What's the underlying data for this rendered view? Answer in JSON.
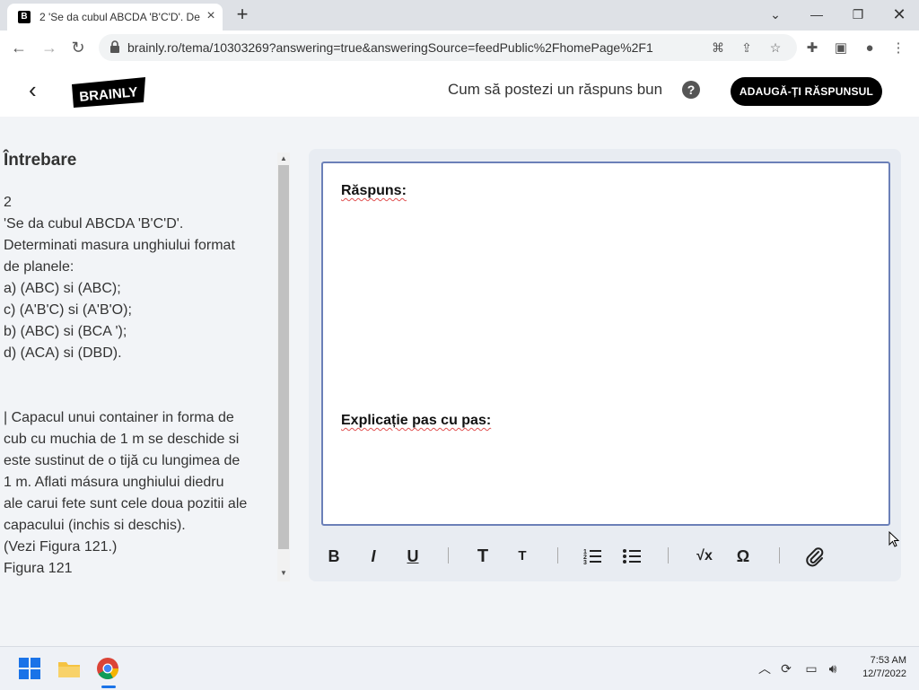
{
  "browser": {
    "tab_title": "2 'Se da cubul ABCDA 'B'C'D'. De",
    "favicon_letter": "B",
    "new_tab": "+",
    "url": "brainly.ro/tema/10303269?answering=true&answeringSource=feedPublic%2FhomePage%2F1"
  },
  "header": {
    "logo_text": "BRAINLY",
    "help_link": "Cum să postezi un răspuns bun",
    "help_icon": "?",
    "add_answer_label": "ADAUGĂ-ȚI RĂSPUNSUL"
  },
  "question": {
    "title": "Întrebare",
    "lines": [
      "2",
      "'Se da cubul ABCDA 'B'C'D'.",
      "Determinati masura unghiului format",
      "de planele:",
      "a) (ABC) si (ABC);",
      "c) (A'B'C) si (A'B'O);",
      "b) (ABC) si (BCA ');",
      "d) (ACA) si (DBD)."
    ],
    "lines2": [
      "| Capacul unui container in forma de",
      "cub cu muchia de 1 m se deschide si",
      "este sustinut de o tijă cu lungimea de",
      "1 m. Aflati másura unghiului diedru",
      "ale carui fete sunt cele doua pozitii ale",
      "capacului (inchis si deschis).",
      "(Vezi Figura 121.)",
      "Figura 121"
    ]
  },
  "editor": {
    "answer_label": "Răspuns:",
    "explanation_label": "Explicație pas cu pas:",
    "toolbar": {
      "bold": "B",
      "italic": "I",
      "underline": "U",
      "heading": "T",
      "subheading": "T",
      "sqrt": "√x",
      "omega": "Ω"
    }
  },
  "taskbar": {
    "time": "7:53 AM",
    "date": "12/7/2022"
  }
}
